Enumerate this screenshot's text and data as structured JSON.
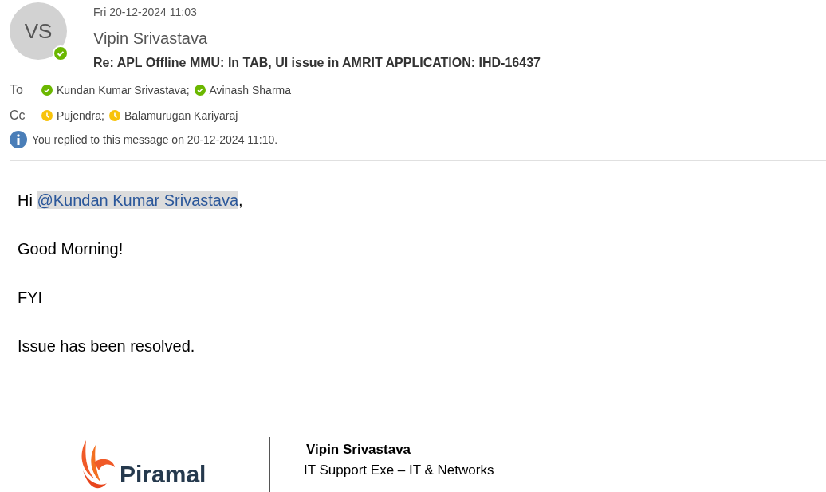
{
  "header": {
    "avatar_initials": "VS",
    "sender_available": true,
    "date": "Fri 20-12-2024 11:03",
    "sender": "Vipin Srivastava",
    "subject": "Re: APL Offline MMU: In TAB, UI issue in AMRIT APPLICATION: IHD-16437"
  },
  "recipients": [
    {
      "label": "To",
      "people": [
        {
          "name": "Kundan Kumar Srivastava;",
          "available": true
        },
        {
          "name": "Avinash Sharma",
          "available": true
        }
      ]
    },
    {
      "label": "Cc",
      "people": [
        {
          "name": "Pujendra;",
          "available": false
        },
        {
          "name": "Balamurugan Kariyaraj",
          "available": false
        }
      ]
    }
  ],
  "info": "You replied to this message on 20-12-2024 11:10.",
  "body": {
    "greeting": "Hi",
    "mention": "@Kundan Kumar Srivastava",
    "greeting_end": ",",
    "paragraphs": [
      "Good Morning!",
      "FYI",
      "Issue has been resolved."
    ]
  },
  "signature": {
    "logo_text": "Piramal",
    "name": "Vipin Srivastava",
    "title": "IT Support Exe – IT & Networks"
  }
}
